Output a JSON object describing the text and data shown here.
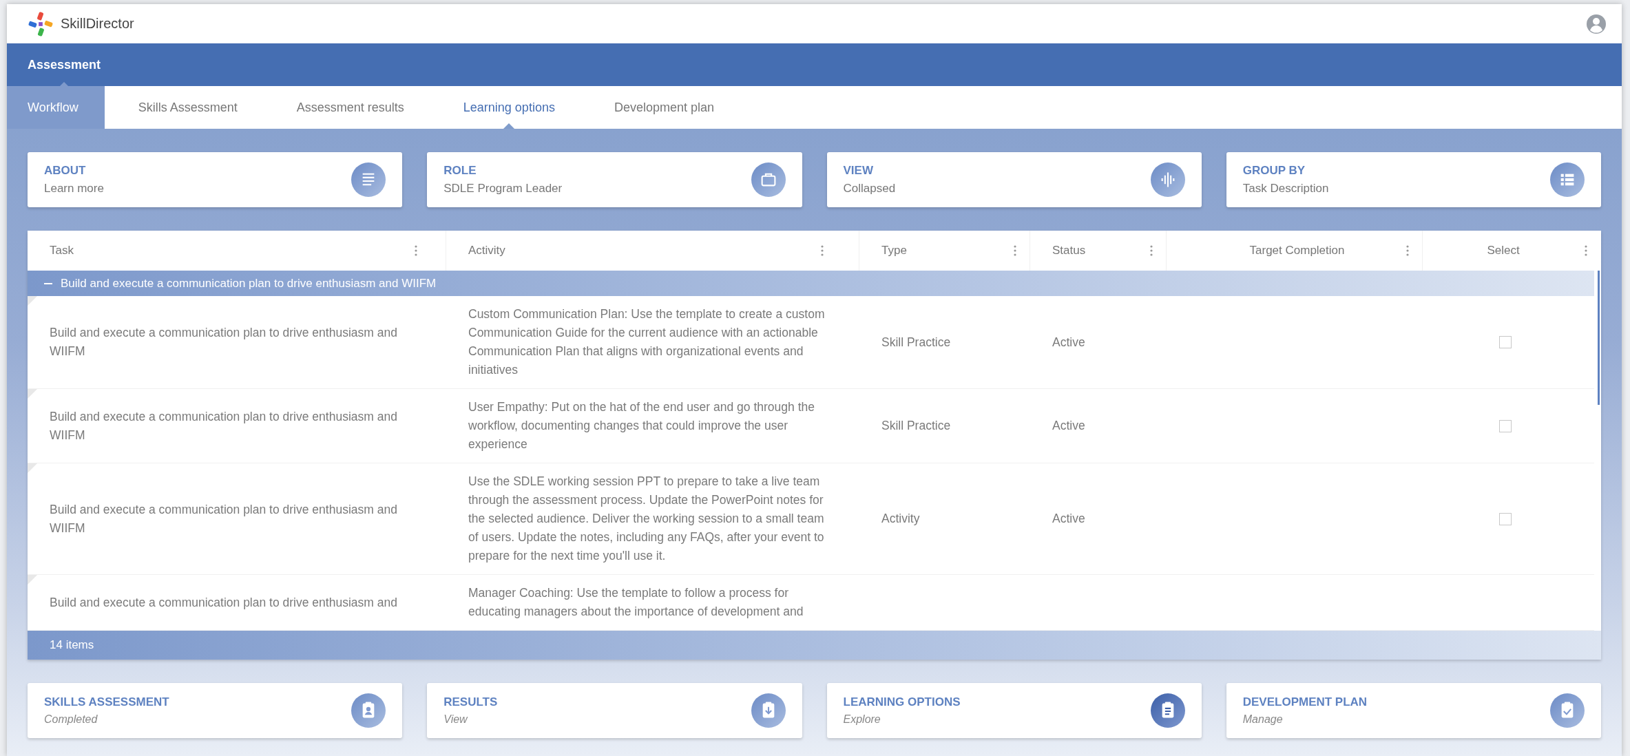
{
  "app": {
    "name": "SkillDirector"
  },
  "nav": [
    {
      "label": "Assessment",
      "selected": true
    }
  ],
  "workflow_button": {
    "label": "Workflow"
  },
  "tabs": [
    {
      "label": "Skills Assessment",
      "selected": false
    },
    {
      "label": "Assessment results",
      "selected": false
    },
    {
      "label": "Learning options",
      "selected": true
    },
    {
      "label": "Development plan",
      "selected": false
    }
  ],
  "filters": [
    {
      "title": "ABOUT",
      "value": "Learn more",
      "kind": "lines"
    },
    {
      "title": "ROLE",
      "value": "SDLE Program Leader",
      "kind": "briefcase"
    },
    {
      "title": "VIEW",
      "value": "Collapsed",
      "kind": "wave"
    },
    {
      "title": "GROUP BY",
      "value": "Task Description",
      "kind": "list"
    }
  ],
  "table": {
    "columns": [
      {
        "label": "Task"
      },
      {
        "label": "Activity"
      },
      {
        "label": "Type"
      },
      {
        "label": "Status"
      },
      {
        "label": "Target Completion"
      },
      {
        "label": "Select"
      }
    ],
    "group": {
      "label": "Build and execute a communication plan to drive enthusiasm and WIIFM",
      "expanded": true
    },
    "rows": [
      {
        "task": "Build and execute a communication plan to drive enthusiasm and WIIFM",
        "activity": "Custom Communication Plan: Use the template to create a custom Communication Guide for the current audience with an actionable Communication Plan that aligns with organizational events and initiatives",
        "type": "Skill Practice",
        "status": "Active",
        "checked": false
      },
      {
        "task": "Build and execute a communication plan to drive enthusiasm and WIIFM",
        "activity": "User Empathy: Put on the hat of the end user and go through the workflow, documenting changes that could improve the user experience",
        "type": "Skill Practice",
        "status": "Active",
        "checked": false
      },
      {
        "task": "Build and execute a communication plan to drive enthusiasm and WIIFM",
        "activity": "Use the SDLE working session PPT to prepare to take a live team through the assessment process. Update the PowerPoint notes for the selected audience. Deliver the working session to a small team of users. Update the notes, including any FAQs, after your event to prepare for the next time you'll use it.",
        "type": "Activity",
        "status": "Active",
        "checked": false
      },
      {
        "task": "Build and execute a communication plan to drive enthusiasm and",
        "activity": "Manager Coaching: Use the template to follow a process for educating managers about the importance of development and"
      }
    ],
    "footer": "14 items"
  },
  "steps": [
    {
      "title": "SKILLS ASSESSMENT",
      "subtitle": "Completed",
      "kind": "person",
      "selected": false
    },
    {
      "title": "RESULTS",
      "subtitle": "View",
      "kind": "download",
      "selected": false
    },
    {
      "title": "LEARNING OPTIONS",
      "subtitle": "Explore",
      "kind": "clipboard",
      "selected": true
    },
    {
      "title": "DEVELOPMENT PLAN",
      "subtitle": "Manage",
      "kind": "check",
      "selected": false
    }
  ]
}
